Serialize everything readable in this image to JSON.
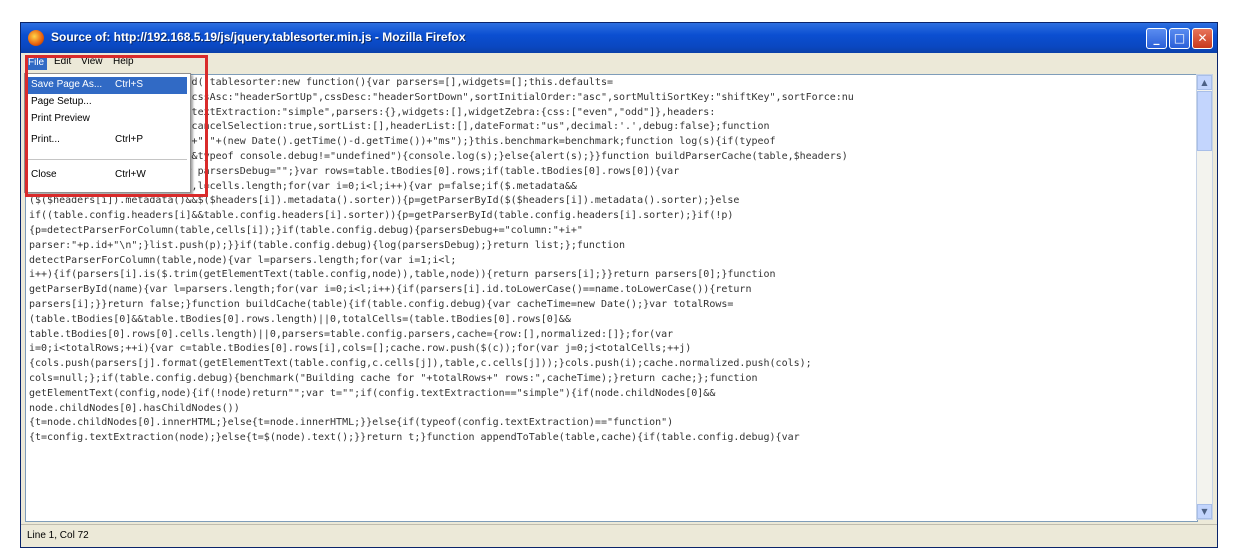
{
  "window": {
    "title": "Source of: http://192.168.5.19/js/jquery.tablesorter.min.js - Mozilla Firefox",
    "controls": {
      "minimize": "_",
      "maximize": "□",
      "close": "✕"
    }
  },
  "menubar": {
    "file": "File",
    "edit": "Edit",
    "view": "View",
    "help": "Help"
  },
  "file_menu": {
    "save": {
      "label": "Save Page As...",
      "shortcut": "Ctrl+S"
    },
    "setup": {
      "label": "Page Setup..."
    },
    "preview": {
      "label": "Print Preview"
    },
    "print": {
      "label": "Print...",
      "shortcut": "Ctrl+P"
    },
    "close": {
      "label": "Close",
      "shortcut": "Ctrl+W"
    }
  },
  "source_lines": [
    "                           d((tablesorter:new function(){var parsers=[],widgets=[];this.defaults=",
    "                           cssAsc:\"headerSortUp\",cssDesc:\"headerSortDown\",sortInitialOrder:\"asc\",sortMultiSortKey:\"shiftKey\",sortForce:nu",
    "                           textExtraction:\"simple\",parsers:{},widgets:[],widgetZebra:{css:[\"even\",\"odd\"]},headers:",
    "                           cancelSelection:true,sortList:[],headerList:[],dateFormat:\"us\",decimal:'.',debug:false};function",
    "                           +\",\"+(new Date().getTime()-d.getTime())+\"ms\");}this.benchmark=benchmark;function log(s){if(typeof",
    "                           &typeof console.debug!=\"undefined\"){console.log(s);}else{alert(s);}}function buildParserCache(table,$headers)",
    "{if(table.config.debug){var parsersDebug=\"\";}var rows=table.tBodies[0].rows;if(table.tBodies[0].rows[0]){var",
    "list=[],cells=rows[0].cells,l=cells.length;for(var i=0;i<l;i++){var p=false;if($.metadata&&",
    "($($headers[i]).metadata()&&$($headers[i]).metadata().sorter)){p=getParserById($($headers[i]).metadata().sorter);}else",
    "if((table.config.headers[i]&&table.config.headers[i].sorter)){p=getParserById(table.config.headers[i].sorter);}if(!p)",
    "{p=detectParserForColumn(table,cells[i]);}if(table.config.debug){parsersDebug+=\"column:\"+i+\"",
    "parser:\"+p.id+\"\\n\";}list.push(p);}}if(table.config.debug){log(parsersDebug);}return list;};function",
    "detectParserForColumn(table,node){var l=parsers.length;for(var i=1;i<l;",
    "i++){if(parsers[i].is($.trim(getElementText(table.config,node)),table,node)){return parsers[i];}}return parsers[0];}function",
    "getParserById(name){var l=parsers.length;for(var i=0;i<l;i++){if(parsers[i].id.toLowerCase()==name.toLowerCase()){return",
    "parsers[i];}}return false;}function buildCache(table){if(table.config.debug){var cacheTime=new Date();}var totalRows=",
    "(table.tBodies[0]&&table.tBodies[0].rows.length)||0,totalCells=(table.tBodies[0].rows[0]&&",
    "table.tBodies[0].rows[0].cells.length)||0,parsers=table.config.parsers,cache={row:[],normalized:[]};for(var",
    "i=0;i<totalRows;++i){var c=table.tBodies[0].rows[i],cols=[];cache.row.push($(c));for(var j=0;j<totalCells;++j)",
    "{cols.push(parsers[j].format(getElementText(table.config,c.cells[j]),table,c.cells[j]));}cols.push(i);cache.normalized.push(cols);",
    "cols=null;};if(table.config.debug){benchmark(\"Building cache for \"+totalRows+\" rows:\",cacheTime);}return cache;};function",
    "getElementText(config,node){if(!node)return\"\";var t=\"\";if(config.textExtraction==\"simple\"){if(node.childNodes[0]&&",
    "node.childNodes[0].hasChildNodes())",
    "{t=node.childNodes[0].innerHTML;}else{t=node.innerHTML;}}else{if(typeof(config.textExtraction)==\"function\")",
    "{t=config.textExtraction(node);}else{t=$(node).text();}}return t;}function appendToTable(table,cache){if(table.config.debug){var"
  ],
  "statusbar": {
    "position": "Line 1, Col 72"
  },
  "scrollbar": {
    "up": "▲",
    "down": "▼"
  }
}
